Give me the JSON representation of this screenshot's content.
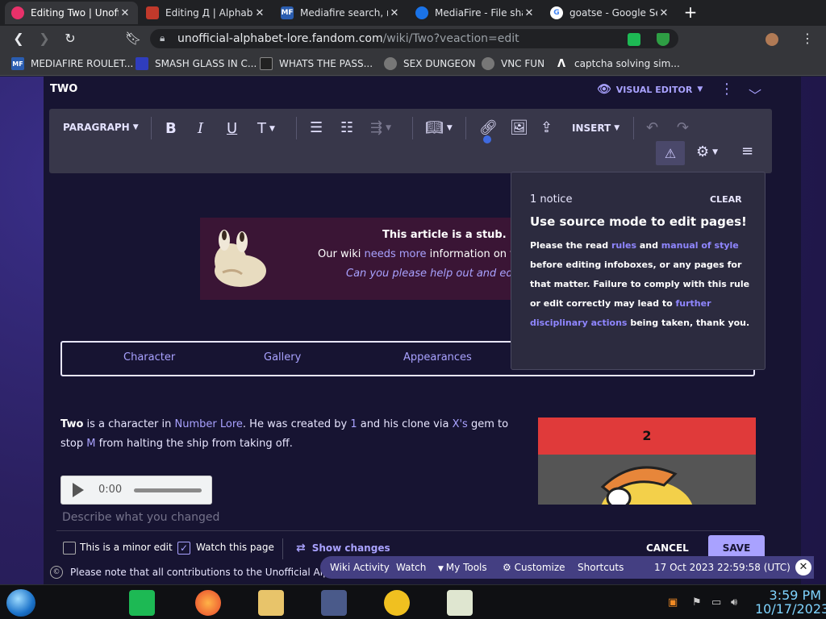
{
  "browser": {
    "tabs": [
      {
        "title": "Editing Two | Unoffic",
        "favicon_color": "#e8316a",
        "favicon_glyph": "",
        "active": true
      },
      {
        "title": "Editing Д | Alphabet",
        "favicon_color": "#c0392b",
        "favicon_glyph": "",
        "active": false
      },
      {
        "title": "Mediafire search, me",
        "favicon_color": "#2a5db0",
        "favicon_glyph": "MF",
        "active": false
      },
      {
        "title": "MediaFire - File shar",
        "favicon_color": "#1a73e8",
        "favicon_glyph": "",
        "active": false
      },
      {
        "title": "goatse - Google Sea",
        "favicon_color": "#ffffff",
        "favicon_glyph": "G",
        "active": false
      }
    ],
    "new_tab": "+",
    "url_host": "unofficial-alphabet-lore.fandom.com",
    "url_path": "/wiki/Two?veaction=edit",
    "bookmarks": [
      {
        "label": "MEDIAFIRE ROULET...",
        "icon": "MF",
        "color": "#2a5db0"
      },
      {
        "label": "SMASH GLASS IN C...",
        "icon": "",
        "color": "#2f3dbd"
      },
      {
        "label": "WHATS THE PASS...",
        "icon": "",
        "color": "#222222"
      },
      {
        "label": "SEX DUNGEON",
        "icon": "",
        "color": "#777777"
      },
      {
        "label": "VNC FUN",
        "icon": "",
        "color": "#777777"
      },
      {
        "label": "captcha solving sim...",
        "icon": "",
        "color": "#35363a"
      }
    ]
  },
  "editor": {
    "page_title": "TWO",
    "visual_editor_label": "VISUAL EDITOR",
    "paragraph_label": "PARAGRAPH",
    "insert_label": "INSERT"
  },
  "notice": {
    "count": "1 notice",
    "clear": "CLEAR",
    "heading": "Use source mode to edit pages!",
    "p1": "Please the read ",
    "link_rules": "rules",
    "p2": " and ",
    "link_style": "manual of style",
    "p3": " before editing infoboxes, or any pages for that matter. Failure to comply with this rule or edit correctly may lead to ",
    "link_actions": "further disciplinary actions",
    "p4": " being taken, thank you."
  },
  "stub": {
    "line1": "This article is a stub.",
    "line2_a": "Our wiki ",
    "line2_link": "needs more",
    "line2_b": " information on t",
    "line3": "Can you please help out and ed"
  },
  "page_tabs": [
    "Character",
    "Gallery",
    "Appearances"
  ],
  "article": {
    "bold": "Two",
    "t1": " is a character in ",
    "link1": "Number Lore",
    "t2": ". He was created by ",
    "link2": "1",
    "t3": " and his clone via ",
    "link3": "X's",
    "t4": " gem to stop ",
    "link4": "M",
    "t5": " from halting the ship from taking off."
  },
  "audio": {
    "time": "0:00"
  },
  "infobox": {
    "title": "2"
  },
  "save": {
    "summary_placeholder": "Describe what you changed",
    "minor_edit": "This is a minor edit",
    "watch_page": "Watch this page",
    "minor_checked": false,
    "watch_checked": true,
    "show_changes": "Show changes",
    "cancel": "CANCEL",
    "save": "SAVE",
    "license_note": "Please note that all contributions to the Unofficial Alphab"
  },
  "fandom_toolbar": {
    "items": [
      "Wiki Activity",
      "Watch",
      "My Tools",
      "Customize",
      "Shortcuts"
    ],
    "timestamp": "17 Oct 2023 22:59:58 (UTC)"
  },
  "taskbar": {
    "time": "3:59 PM",
    "date": "10/17/2023"
  },
  "colors": {
    "accent": "#a9a2ff",
    "save_button": "#a9a2ff",
    "infobox_header": "#e03a3a"
  }
}
